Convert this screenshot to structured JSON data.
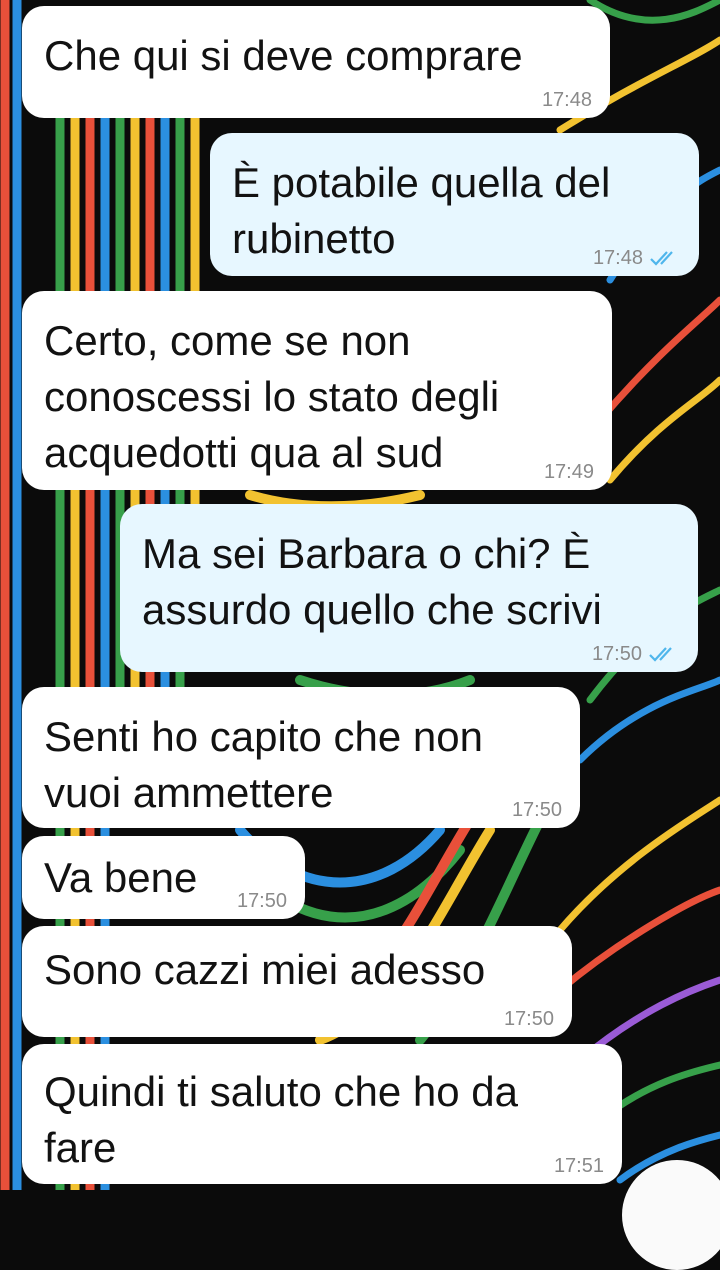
{
  "theme": {
    "incoming_bubble": "#ffffff",
    "outgoing_bubble": "#e7f7ff",
    "read_tick_color": "#4fb6ec",
    "timestamp_color": "#8a8a8a"
  },
  "messages": [
    {
      "direction": "incoming",
      "text": "Che qui si deve comprare",
      "time": "17:48"
    },
    {
      "direction": "outgoing",
      "text": "È potabile quella del\nrubinetto",
      "time": "17:48",
      "status": "read-double-tick"
    },
    {
      "direction": "incoming",
      "text": "Certo, come se non\nconoscessi lo stato degli\nacquedotti qua al sud",
      "time": "17:49"
    },
    {
      "direction": "outgoing",
      "text": "Ma sei Barbara o chi? È\nassurdo quello che scrivi",
      "time": "17:50",
      "status": "read-double-tick"
    },
    {
      "direction": "incoming",
      "text": "Senti ho capito che non\nvuoi ammettere",
      "time": "17:50"
    },
    {
      "direction": "incoming",
      "text": "Va bene",
      "time": "17:50"
    },
    {
      "direction": "incoming",
      "text": "Sono cazzi miei adesso",
      "time": "17:50"
    },
    {
      "direction": "incoming",
      "text": "Quindi ti saluto che ho da\nfare",
      "time": "17:51"
    }
  ]
}
